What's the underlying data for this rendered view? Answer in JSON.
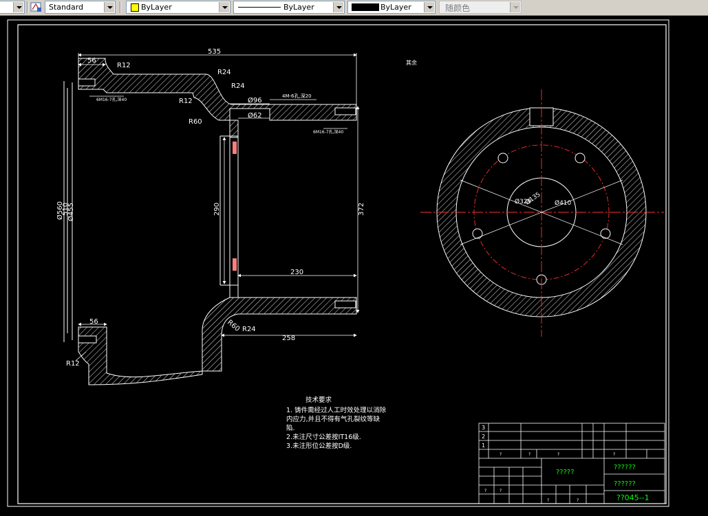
{
  "toolbar": {
    "text_style": "Standard",
    "layer": "ByLayer",
    "linetype": "ByLayer",
    "lineweight": "ByLayer",
    "plot_style": "随颜色",
    "colors": {
      "layer_swatch": "#ffff00",
      "lineweight_swatch": "#000000",
      "plot_style_text": "#7f7f7f"
    }
  },
  "drawing": {
    "colors": {
      "background": "#000000",
      "lines": "#ffffff",
      "dimensions": "#ffffff",
      "centerlines": "#ff0000",
      "hatch": "#ffffff",
      "title_text": "#00ff00",
      "frame": "#ffffff"
    },
    "dims": {
      "d535": "535",
      "d56_top": "56",
      "d56_bot": "56",
      "r12_top": "R12",
      "r24_a": "R24",
      "r24_b": "R24",
      "r12_mid": "R12",
      "r60_top": "R60",
      "d96": "Ø96",
      "d62": "Ø62",
      "hole_note_top": "4M-6孔,深20",
      "thread_note_1": "6M16-7孔,深40",
      "thread_note_2": "6M16-7孔,深40",
      "d560": "Ø560",
      "d510": "510",
      "d455": "Ø455",
      "d290": "290",
      "d372": "372",
      "d230": "230",
      "r60_bot": "R60",
      "r24_bot": "R24",
      "d258": "258",
      "r12_bot": "R12",
      "rough_rest": "其余",
      "d135": "Ø135",
      "d329": "Ø329",
      "d410": "Ø410"
    },
    "tech_req": {
      "title": "技术要求",
      "item1a": "1. 铸件需经过人工时效处理以消除",
      "item1b": "内应力,并且不得有气孔裂纹等缺",
      "item1c": "陷.",
      "item2": "2.未注尺寸公差按IT16级.",
      "item3": "3.未注形位公差按D级."
    },
    "title_block": {
      "row3": "3",
      "row2": "2",
      "row1": "1",
      "part_name": "?????",
      "material": "??????",
      "company": "??????",
      "drawing_no": "??045--1",
      "q": "?"
    }
  }
}
